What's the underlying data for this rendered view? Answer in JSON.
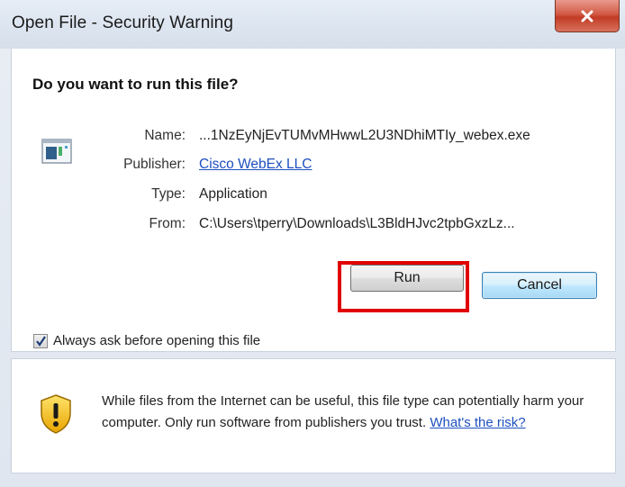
{
  "window": {
    "title": "Open File - Security Warning"
  },
  "prompt": {
    "question": "Do you want to run this file?"
  },
  "file_info": {
    "name_label": "Name:",
    "name_value": "...1NzEyNjEvTUMvMHwwL2U3NDhiMTIy_webex.exe",
    "publisher_label": "Publisher:",
    "publisher_value": "Cisco WebEx LLC",
    "type_label": "Type:",
    "type_value": "Application",
    "from_label": "From:",
    "from_value": "C:\\Users\\tperry\\Downloads\\L3BldHJvc2tpbGxzLz..."
  },
  "buttons": {
    "run_label": "Run",
    "cancel_label": "Cancel"
  },
  "options": {
    "always_ask_label": "Always ask before opening this file",
    "always_ask_checked": true
  },
  "warning": {
    "text": "While files from the Internet can be useful, this file type can potentially harm your computer. Only run software from publishers you trust.",
    "risk_link": "What's the risk?"
  },
  "colors": {
    "highlight": "#e00000",
    "link": "#1d4fbf"
  },
  "icons": {
    "close": "close-icon",
    "file": "application-file-icon",
    "checkbox": "checkmark-icon",
    "shield": "warning-shield-icon"
  }
}
